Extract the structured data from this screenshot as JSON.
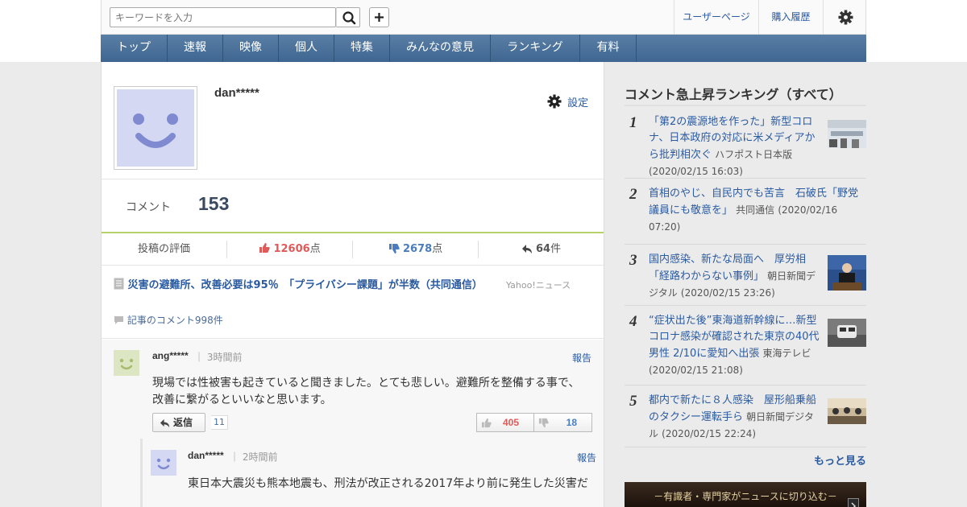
{
  "header": {
    "search_placeholder": "キーワードを入力",
    "user_page_link": "ユーザーページ",
    "purchase_history_link": "購入履歴"
  },
  "nav": {
    "items": [
      "トップ",
      "速報",
      "映像",
      "個人",
      "特集",
      "みんなの意見",
      "ランキング",
      "有料"
    ]
  },
  "profile": {
    "username": "dan*****",
    "settings_label": "設定",
    "comment_label": "コメント",
    "comment_count": "153"
  },
  "stats": {
    "rating_label": "投稿の評価",
    "likes": "12606",
    "likes_unit": "点",
    "dislikes": "2678",
    "dislikes_unit": "点",
    "replies": "64",
    "replies_unit": "件"
  },
  "article": {
    "title": "災害の避難所、改善必要は95％　「プライバシー課題」が半数（共同通信）",
    "source": "Yahoo!ニュース",
    "comments_link": "記事のコメント998件"
  },
  "comment": {
    "user": "ang*****",
    "time": "3時間前",
    "report": "報告",
    "text": "現場では性被害も起きていると聞きました。とても悲しい。避難所を整備する事で、改善に繋がるといいなと思います。",
    "reply_label": "返信",
    "reply_count": "11",
    "likes": "405",
    "dislikes": "18"
  },
  "reply": {
    "user": "dan*****",
    "time": "2時間前",
    "report": "報告",
    "text": "東日本大震災も熊本地震も、刑法が改正される2017年より前に発生した災害だ"
  },
  "sidebar": {
    "title": "コメント急上昇ランキング（すべて）",
    "items": [
      {
        "rank": "1",
        "title": "「第2の震源地を作った」新型コロナ、日本政府の対応に米メディアから批判相次ぐ",
        "source": "ハフポスト日本版",
        "date": "(2020/02/15 16:03)"
      },
      {
        "rank": "2",
        "title": "首相のやじ、自民内でも苦言　石破氏「野党議員にも敬意を」",
        "source": "共同通信",
        "date": "(2020/02/16 07:20)"
      },
      {
        "rank": "3",
        "title": "国内感染、新たな局面へ　厚労相「経路わからない事例」",
        "source": "朝日新聞デジタル",
        "date": "(2020/02/15 23:26)"
      },
      {
        "rank": "4",
        "title": "“症状出た後”東海道新幹線に…新型コロナ感染が確認された東京の40代男性 2/10に愛知へ出張",
        "source": "東海テレビ",
        "date": "(2020/02/15 21:08)"
      },
      {
        "rank": "5",
        "title": "都内で新たに８人感染　屋形船乗船のタクシー運転手ら",
        "source": "朝日新聞デジタル",
        "date": "(2020/02/15 22:24)"
      }
    ],
    "more_link": "もっと見る",
    "banner_text": "－有識者・専門家がニュースに切り込む－"
  },
  "colors": {
    "accent": "#2a5aa0",
    "nav_bg": "#4a729a",
    "like": "#e05a5a",
    "dislike": "#4a7cc0",
    "avatar_self": "#d4d8f2",
    "avatar_other": "#dde6c2"
  }
}
